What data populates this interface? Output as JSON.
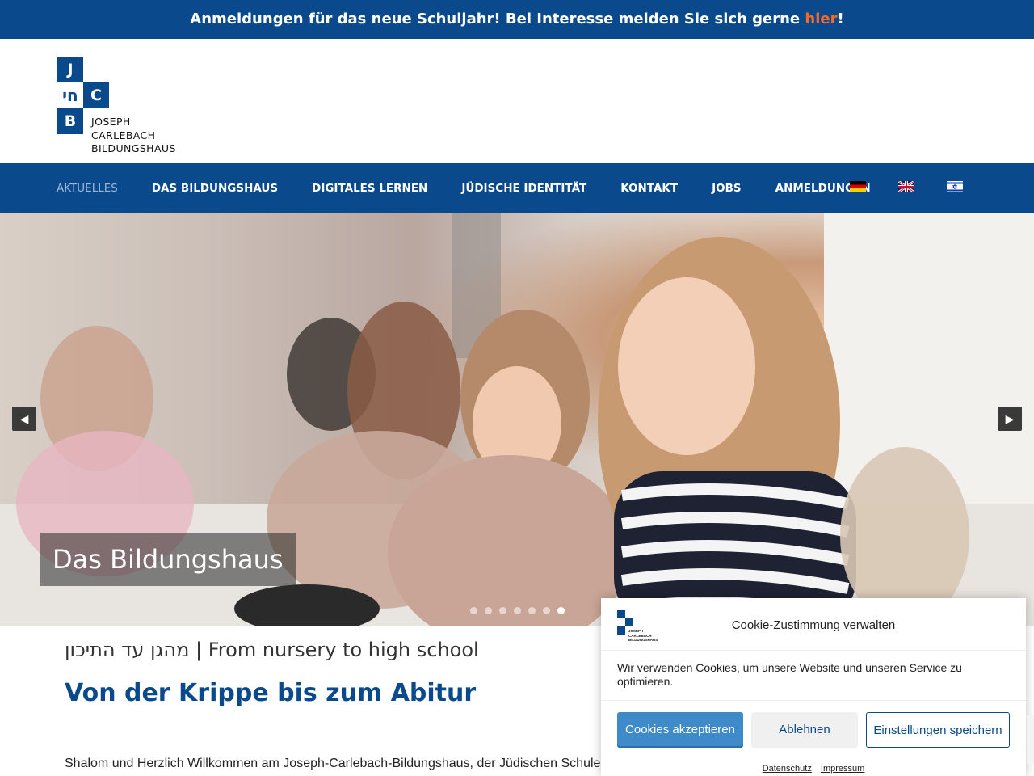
{
  "announcement": {
    "text": "Anmeldungen für das neue Schuljahr! Bei Interesse melden Sie sich gerne ",
    "link": "hier",
    "suffix": "!"
  },
  "logo": {
    "letter_j": "J",
    "letter_hebrew": "חי",
    "letter_c": "C",
    "letter_b": "B",
    "line1": "JOSEPH",
    "line2": "CARLEBACH",
    "line3": "BILDUNGSHAUS"
  },
  "nav": {
    "items": [
      {
        "label": "AKTUELLES",
        "active": true
      },
      {
        "label": "DAS BILDUNGSHAUS"
      },
      {
        "label": "DIGITALES LERNEN"
      },
      {
        "label": "JÜDISCHE IDENTITÄT"
      },
      {
        "label": "KONTAKT"
      },
      {
        "label": "JOBS"
      },
      {
        "label": "ANMELDUNGEN"
      }
    ],
    "flags": [
      "german-flag-icon",
      "uk-flag-icon",
      "israel-flag-icon"
    ]
  },
  "hero": {
    "caption": "Das Bildungshaus",
    "prev_icon": "◀",
    "next_icon": "▶",
    "slide_count": 7,
    "active_slide": 6
  },
  "content": {
    "sub_heading": "מהגן עד התיכון | From nursery to high school",
    "main_heading": "Von der Krippe bis zum Abitur",
    "intro": "Shalom und Herzlich Willkommen am Joseph-Carlebach-Bildungshaus, der Jüdischen Schule i"
  },
  "cookie": {
    "title": "Cookie-Zustimmung verwalten",
    "message": "Wir verwenden Cookies, um unsere Website und unseren Service zu optimieren.",
    "accept_label": "Cookies akzeptieren",
    "reject_label": "Ablehnen",
    "save_label": "Einstellungen speichern",
    "privacy_link": "Datenschutz",
    "imprint_link": "Impressum",
    "logo_line1": "JOSEPH",
    "logo_line2": "CARLEBACH",
    "logo_line3": "BILDUNGSHAUS"
  },
  "colors": {
    "brand_blue": "#0a4a8c",
    "highlight_orange": "#f26b2b",
    "accept_button": "#3f8ac9"
  }
}
